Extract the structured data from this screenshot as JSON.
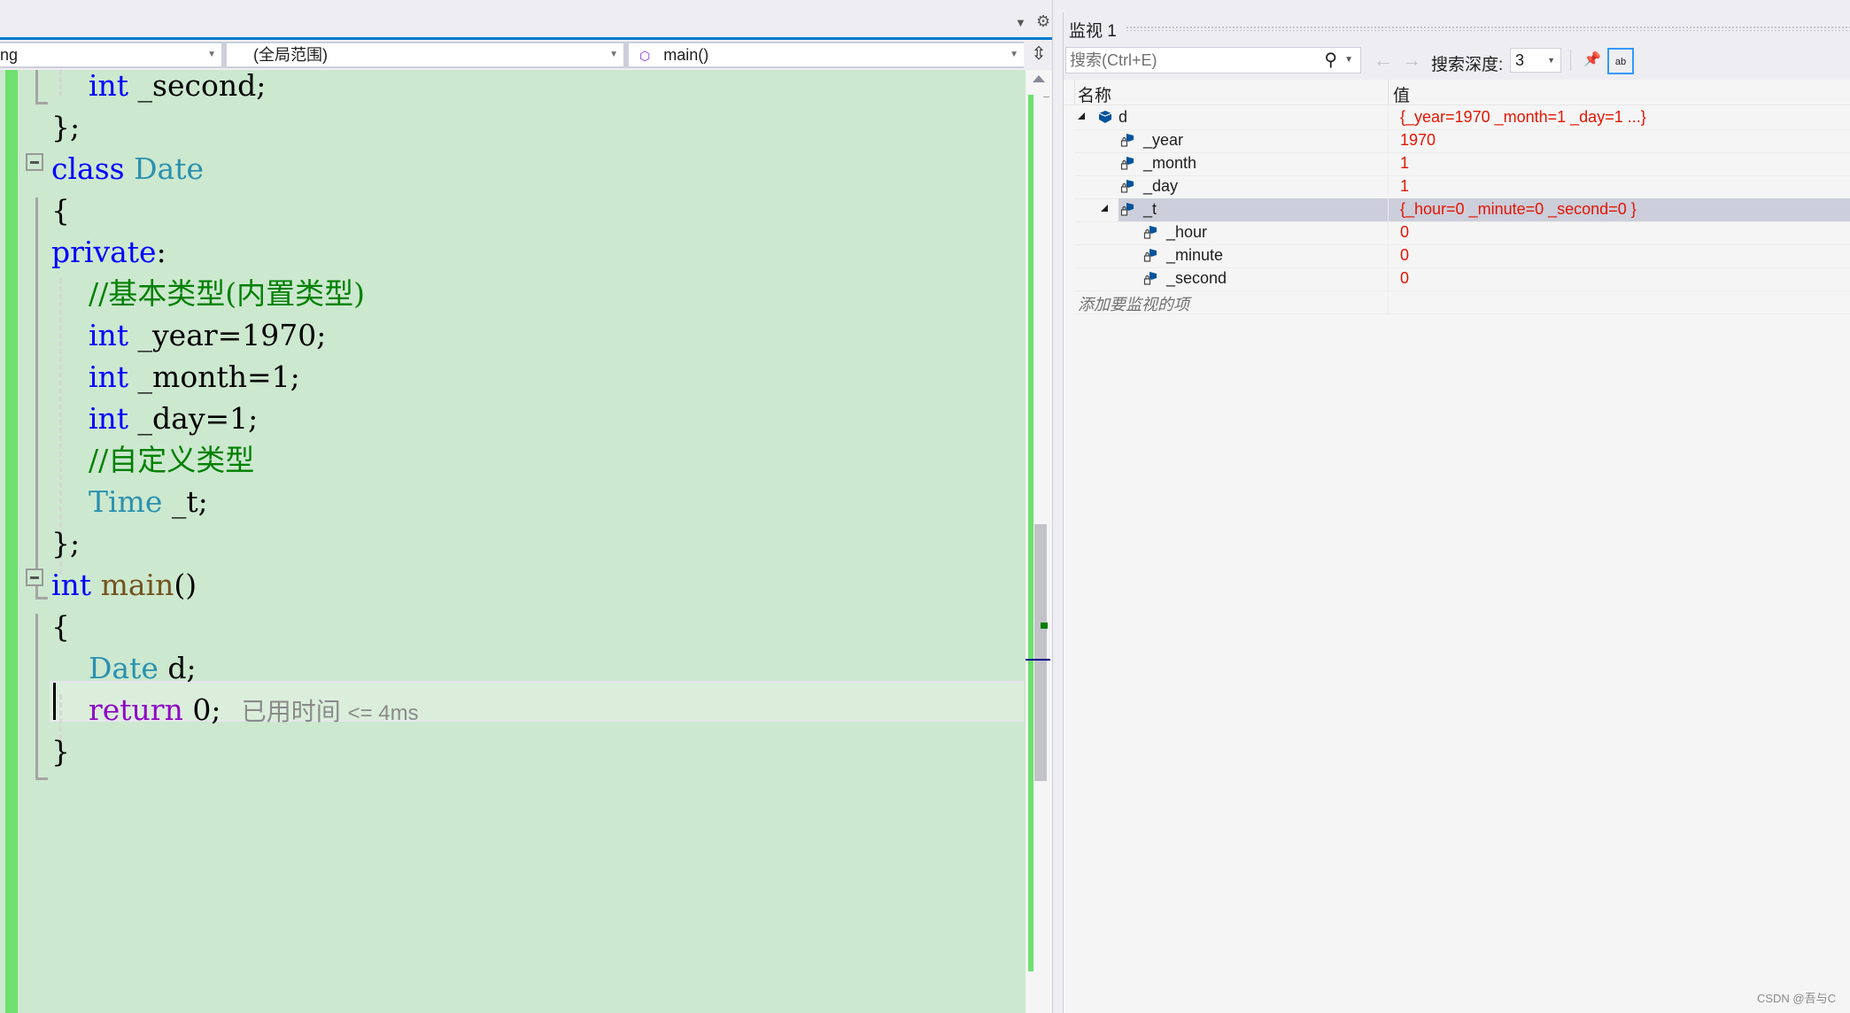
{
  "top": {
    "dropdown_icon": "triangle-down-icon",
    "settings_icon": "gear-icon"
  },
  "navbar": {
    "project_dropdown": "ng",
    "scope_dropdown": "(全局范围)",
    "member_dropdown": "main()",
    "member_icon": "method-cube-icon",
    "split_icon": "split-editor-icon"
  },
  "editor": {
    "lines": [
      {
        "parts": [
          [
            "",
            "    "
          ],
          [
            "kw",
            "int"
          ],
          [
            "",
            " _second;"
          ]
        ]
      },
      {
        "parts": [
          [
            "",
            "};"
          ]
        ]
      },
      {
        "parts": [
          [
            "kw",
            "class"
          ],
          [
            "",
            " "
          ],
          [
            "ty",
            "Date"
          ]
        ]
      },
      {
        "parts": [
          [
            "",
            "{"
          ]
        ]
      },
      {
        "parts": [
          [
            "kw",
            "private"
          ],
          [
            "",
            ":"
          ]
        ]
      },
      {
        "parts": [
          [
            "",
            "    "
          ],
          [
            "cm",
            "//基本类型(内置类型)"
          ]
        ]
      },
      {
        "parts": [
          [
            "",
            "    "
          ],
          [
            "kw",
            "int"
          ],
          [
            "",
            " _year=1970;"
          ]
        ]
      },
      {
        "parts": [
          [
            "",
            "    "
          ],
          [
            "kw",
            "int"
          ],
          [
            "",
            " _month=1;"
          ]
        ]
      },
      {
        "parts": [
          [
            "",
            "    "
          ],
          [
            "kw",
            "int"
          ],
          [
            "",
            " _day=1;"
          ]
        ]
      },
      {
        "parts": [
          [
            "",
            "    "
          ],
          [
            "cm",
            "//自定义类型"
          ]
        ]
      },
      {
        "parts": [
          [
            "",
            "    "
          ],
          [
            "ty",
            "Time"
          ],
          [
            "",
            " _t;"
          ]
        ]
      },
      {
        "parts": [
          [
            "",
            "};"
          ]
        ]
      },
      {
        "parts": [
          [
            "kw",
            "int"
          ],
          [
            "",
            " "
          ],
          [
            "fn",
            "main"
          ],
          [
            "",
            "()"
          ]
        ]
      },
      {
        "parts": [
          [
            "",
            "{"
          ]
        ]
      },
      {
        "parts": [
          [
            "",
            "    "
          ],
          [
            "ty",
            "Date"
          ],
          [
            "",
            " d;"
          ]
        ]
      },
      {
        "parts": [
          [
            "",
            "    "
          ],
          [
            "ret",
            "return"
          ],
          [
            "",
            " 0;"
          ]
        ]
      },
      {
        "parts": [
          [
            "",
            "}"
          ]
        ]
      }
    ],
    "perf_tip_label": "已用时间",
    "perf_tip_value": "<= 4ms"
  },
  "watch": {
    "title": "监视 1",
    "search_placeholder": "搜索(Ctrl+E)",
    "search_icon": "search-icon",
    "back_icon": "arrow-left-icon",
    "forward_icon": "arrow-right-icon",
    "depth_label": "搜索深度:",
    "depth_value": "3",
    "filter_icon": "pin-filter-icon",
    "hex_icon": "view-format-icon",
    "col_name": "名称",
    "col_value": "值",
    "rows": [
      {
        "name": "d",
        "value": "{_year=1970 _month=1 _day=1 ...}",
        "level": 0,
        "expanded": true,
        "icon": "object-icon"
      },
      {
        "name": "_year",
        "value": "1970",
        "level": 1,
        "icon": "private-field-icon"
      },
      {
        "name": "_month",
        "value": "1",
        "level": 1,
        "icon": "private-field-icon"
      },
      {
        "name": "_day",
        "value": "1",
        "level": 1,
        "icon": "private-field-icon"
      },
      {
        "name": "_t",
        "value": "{_hour=0 _minute=0 _second=0 }",
        "level": 1,
        "expanded": true,
        "selected": true,
        "icon": "private-field-icon"
      },
      {
        "name": "_hour",
        "value": "0",
        "level": 2,
        "icon": "private-field-icon"
      },
      {
        "name": "_minute",
        "value": "0",
        "level": 2,
        "icon": "private-field-icon"
      },
      {
        "name": "_second",
        "value": "0",
        "level": 2,
        "icon": "private-field-icon"
      }
    ],
    "add_item_placeholder": "添加要监视的项"
  },
  "watermark": "CSDN @吾与C",
  "colors": {
    "editor_bg": "#cce8cf",
    "keyword": "#0000ff",
    "type": "#2b91af",
    "comment": "#008000",
    "function": "#74531f",
    "control": "#8f08c4",
    "watch_value": "#e51400",
    "accent": "#007acc"
  }
}
